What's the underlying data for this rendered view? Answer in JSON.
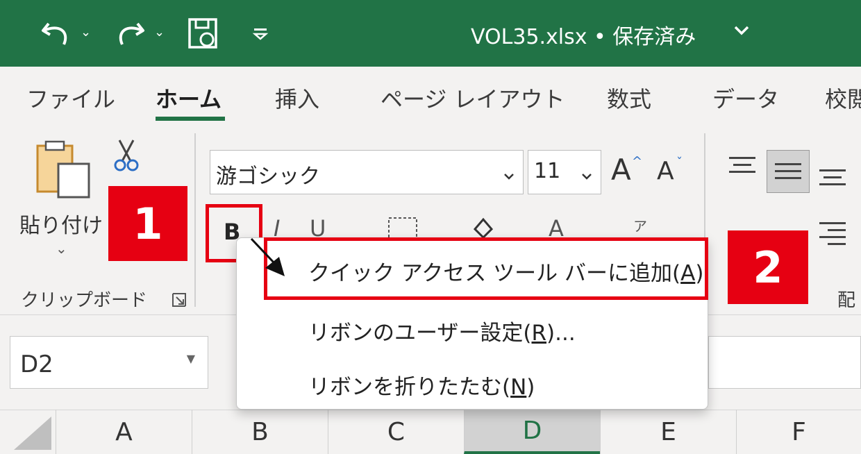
{
  "titlebar": {
    "document_title": "VOL35.xlsx • 保存済み",
    "icons": [
      "undo-icon",
      "redo-icon",
      "autosave-icon",
      "customize-qat-icon"
    ]
  },
  "tabs": [
    {
      "label": "ファイル"
    },
    {
      "label": "ホーム"
    },
    {
      "label": "挿入"
    },
    {
      "label": "ページ レイアウト"
    },
    {
      "label": "数式"
    },
    {
      "label": "データ"
    },
    {
      "label": "校閲"
    }
  ],
  "ribbon": {
    "clipboard": {
      "paste_label": "貼り付け",
      "group_label": "クリップボード"
    },
    "font": {
      "font_name": "游ゴシック",
      "font_size": "11",
      "bold_label": "B",
      "italic_label": "I",
      "underline_label": "U",
      "color_label": "A",
      "phonetic_label": "ア"
    },
    "alignment": {
      "group_label": "配"
    }
  },
  "badges": {
    "step1": "1",
    "step2": "2"
  },
  "namebox": {
    "value": "D2"
  },
  "columns": [
    "A",
    "B",
    "C",
    "D",
    "E",
    "F"
  ],
  "selected_column": "D",
  "context_menu": {
    "items": [
      {
        "text": "クイック アクセス ツール バーに追加(",
        "key": "A",
        "suffix": ")"
      },
      {
        "text": "リボンのユーザー設定(",
        "key": "R",
        "suffix": ")..."
      },
      {
        "text": "リボンを折りたたむ(",
        "key": "N",
        "suffix": ")"
      }
    ]
  },
  "colors": {
    "titlebar": "#217346",
    "highlight_red": "#e60012",
    "ribbon_bg": "#f3f2f1"
  }
}
